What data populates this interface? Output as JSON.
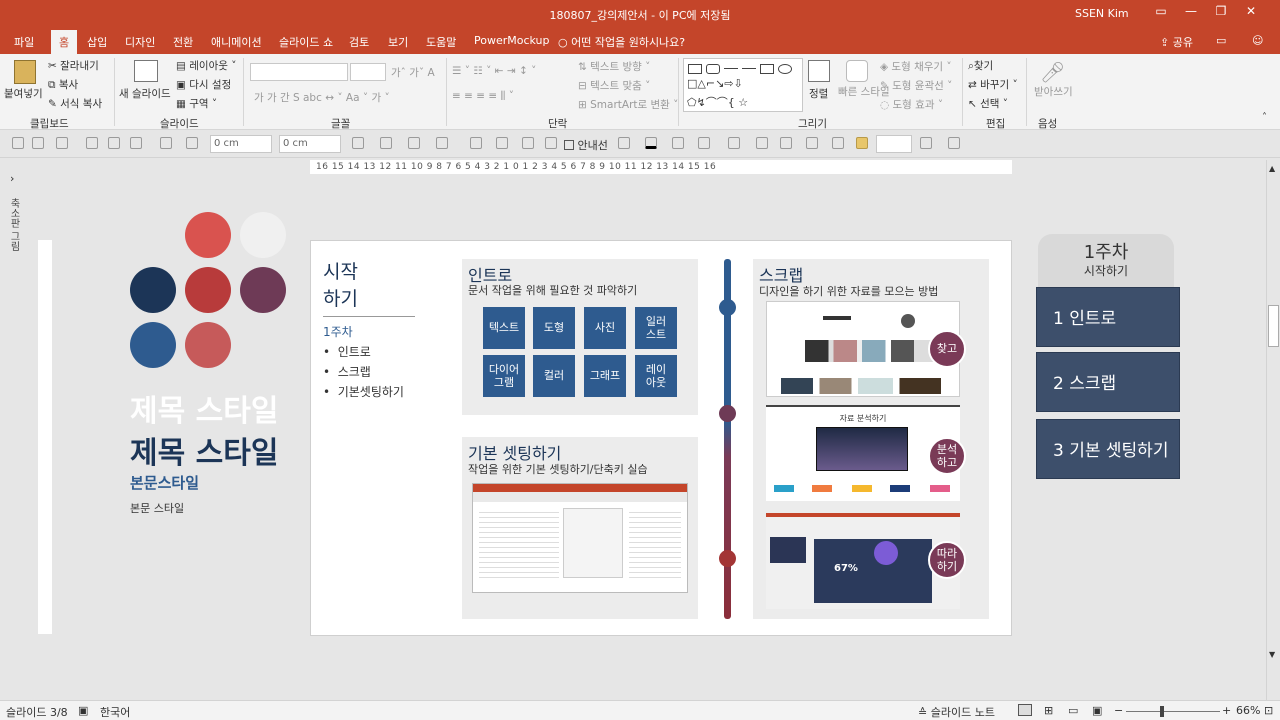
{
  "window": {
    "title": "180807_강의제안서 - 이 PC에 저장됨",
    "user": "SSEN Kim"
  },
  "tabs": [
    "파일",
    "홈",
    "삽입",
    "디자인",
    "전환",
    "애니메이션",
    "슬라이드 쇼",
    "검토",
    "보기",
    "도움말",
    "PowerMockup"
  ],
  "tell_me": "어떤 작업을 원하시나요?",
  "share": "공유",
  "ribbon": {
    "clipboard": {
      "paste": "붙여넣기",
      "cut": "잘라내기",
      "copy": "복사",
      "format_painter": "서식 복사",
      "label": "클립보드"
    },
    "slides": {
      "new_slide": "새 슬라이드",
      "layout": "레이아웃",
      "reset": "다시 설정",
      "section": "구역",
      "label": "슬라이드"
    },
    "font": {
      "label": "글꼴"
    },
    "paragraph": {
      "text_direction": "텍스트 방향",
      "align_text": "텍스트 맞춤",
      "smartart": "SmartArt로 변환",
      "label": "단락"
    },
    "drawing": {
      "arrange": "정렬",
      "quick_styles": "빠른 스타일",
      "fill": "도형 채우기",
      "outline": "도형 윤곽선",
      "effects": "도형 효과",
      "label": "그리기"
    },
    "editing": {
      "find": "찾기",
      "replace": "바꾸기",
      "select": "선택",
      "label": "편집"
    },
    "voice": {
      "dictate": "받아쓰기",
      "label": "음성"
    }
  },
  "toolbar2": {
    "width_value": "0 cm",
    "height_value": "0 cm",
    "guides": "안내선"
  },
  "ruler_text": "16 15 14 13 12 11 10 9 8 7 6 5 4 3 2 1 0 1 2 3 4 5 6 7 8 9 10 11 12 13 14 15 16",
  "thumbnail_pane": "축소판 그림",
  "canvas_left": {
    "title_light": "제목 스타일",
    "title_dark": "제목 스타일",
    "body_style": "본문스타일",
    "body_style_small": "본문 스타일"
  },
  "slide": {
    "start_title": "시작\n하기",
    "week": "1주차",
    "bullets": [
      "인트로",
      "스크랩",
      "기본셋팅하기"
    ],
    "intro": {
      "title": "인트로",
      "subtitle": "문서 작업을 위해 필요한 것 파악하기",
      "buttons": [
        "텍스트",
        "도형",
        "사진",
        "일러\n스트",
        "다이어\n그램",
        "컬러",
        "그래프",
        "레이\n아웃"
      ]
    },
    "setup": {
      "title": "기본 셋팅하기",
      "subtitle": "작업을 위한 기본 셋팅하기/단축키 실습"
    },
    "scrap": {
      "title": "스크랩",
      "subtitle": "디자인을 하기 위한 자료를 모으는 방법",
      "badges": [
        "찾고",
        "분석\n하고",
        "따라\n하기"
      ],
      "analysis_caption": "자료 분석하기",
      "progress_text": "67%"
    }
  },
  "right_nav": {
    "header_title": "1주차",
    "header_sub": "시작하기",
    "items": [
      "1 인트로",
      "2 스크랩",
      "3 기본 셋팅하기"
    ]
  },
  "status": {
    "slide_no": "슬라이드 3/8",
    "language": "한국어",
    "notes": "슬라이드 노트",
    "zoom": "66%"
  },
  "colors": {
    "accent": "#c4452a",
    "navy": "#2e5b8f",
    "plum": "#7a3a57",
    "dark_red": "#8b2e3a",
    "nav_box": "#3d4f6b"
  }
}
